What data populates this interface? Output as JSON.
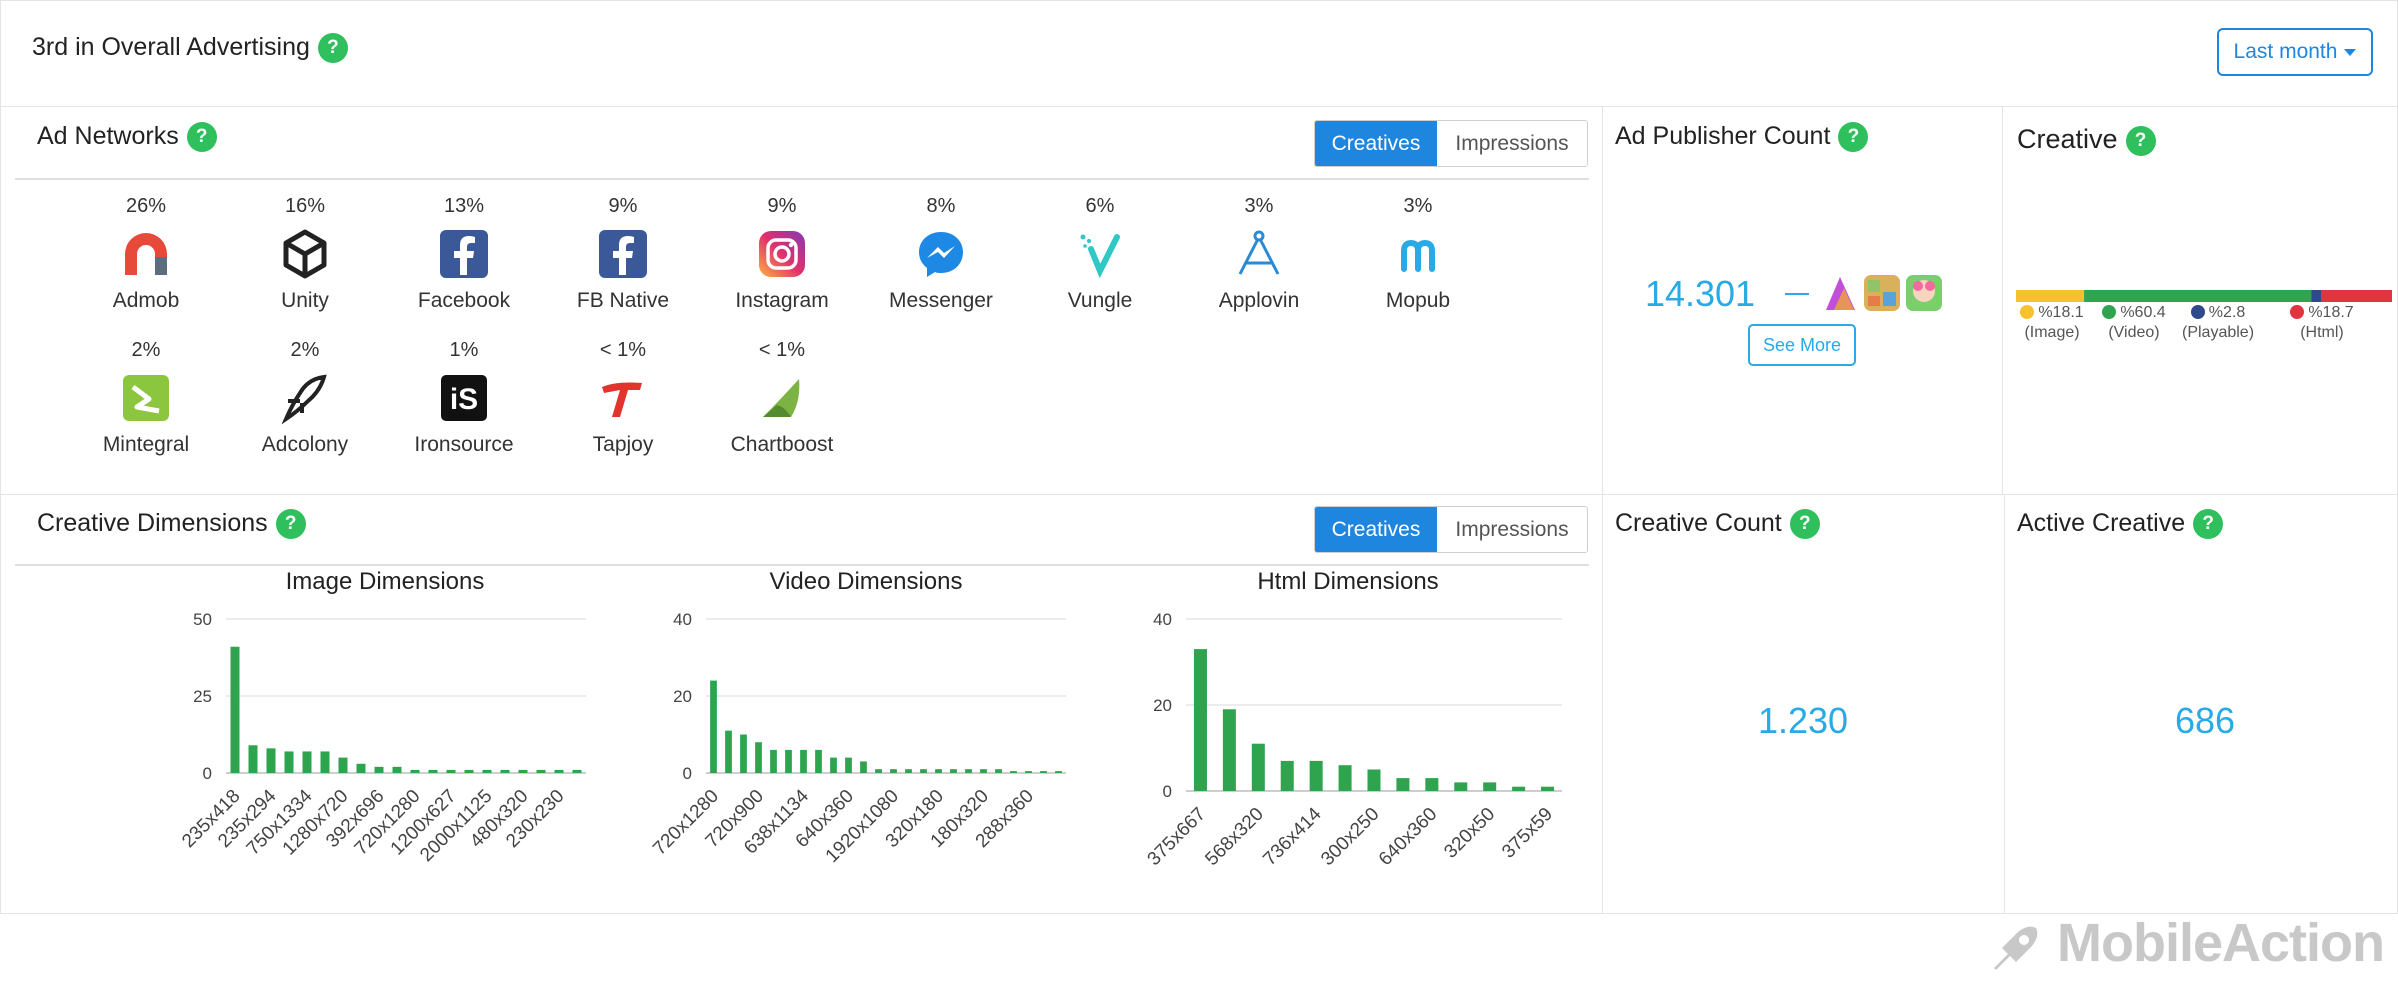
{
  "header": {
    "title": "3rd in Overall Advertising",
    "period": "Last month"
  },
  "help_glyph": "?",
  "ad_networks": {
    "title": "Ad Networks",
    "toggle": {
      "active": "Creatives",
      "inactive": "Impressions"
    },
    "items": [
      {
        "pct": "26%",
        "name": "Admob",
        "icon": "admob-icon"
      },
      {
        "pct": "16%",
        "name": "Unity",
        "icon": "unity-icon"
      },
      {
        "pct": "13%",
        "name": "Facebook",
        "icon": "facebook-icon"
      },
      {
        "pct": "9%",
        "name": "FB Native",
        "icon": "fb-native-icon"
      },
      {
        "pct": "9%",
        "name": "Instagram",
        "icon": "instagram-icon"
      },
      {
        "pct": "8%",
        "name": "Messenger",
        "icon": "messenger-icon"
      },
      {
        "pct": "6%",
        "name": "Vungle",
        "icon": "vungle-icon"
      },
      {
        "pct": "3%",
        "name": "Applovin",
        "icon": "applovin-icon"
      },
      {
        "pct": "3%",
        "name": "Mopub",
        "icon": "mopub-icon"
      },
      {
        "pct": "2%",
        "name": "Mintegral",
        "icon": "mintegral-icon"
      },
      {
        "pct": "2%",
        "name": "Adcolony",
        "icon": "adcolony-icon"
      },
      {
        "pct": "1%",
        "name": "Ironsource",
        "icon": "ironsource-icon"
      },
      {
        "pct": "< 1%",
        "name": "Tapjoy",
        "icon": "tapjoy-icon"
      },
      {
        "pct": "< 1%",
        "name": "Chartboost",
        "icon": "chartboost-icon"
      }
    ]
  },
  "publisher": {
    "title": "Ad Publisher Count",
    "count": "14.301",
    "see_more": "See More"
  },
  "creative": {
    "title": "Creative",
    "segments": [
      {
        "label": "%18.1",
        "type": "(Image)",
        "value": 18.1,
        "color": "#f5c12e"
      },
      {
        "label": "%60.4",
        "type": "(Video)",
        "value": 60.4,
        "color": "#2ea44f"
      },
      {
        "label": "%2.8",
        "type": "(Playable)",
        "value": 2.8,
        "color": "#2e4a8a"
      },
      {
        "label": "%18.7",
        "type": "(Html)",
        "value": 18.7,
        "color": "#e0343f"
      }
    ]
  },
  "dimensions": {
    "title": "Creative Dimensions",
    "toggle": {
      "active": "Creatives",
      "inactive": "Impressions"
    }
  },
  "creative_count": {
    "title": "Creative Count",
    "value": "1.230"
  },
  "active_creative": {
    "title": "Active Creative",
    "value": "686"
  },
  "brand": "MobileAction",
  "chart_data": [
    {
      "type": "bar",
      "title": "Image Dimensions",
      "ylim": [
        0,
        50
      ],
      "yticks": [
        0,
        25,
        50
      ],
      "tick_labels": [
        "235x418",
        "235x294",
        "750x1334",
        "1280x720",
        "392x696",
        "720x1280",
        "1200x627",
        "2000x1125",
        "480x320",
        "230x230"
      ],
      "values": [
        41,
        9,
        8,
        7,
        7,
        7,
        5,
        3,
        2,
        2,
        1,
        1,
        1,
        1,
        1,
        1,
        1,
        1,
        1,
        1
      ],
      "color": "#2ea44f"
    },
    {
      "type": "bar",
      "title": "Video Dimensions",
      "ylim": [
        0,
        40
      ],
      "yticks": [
        0,
        20,
        40
      ],
      "tick_labels": [
        "720x1280",
        "720x900",
        "638x1134",
        "640x360",
        "1920x1080",
        "320x180",
        "180x320",
        "288x360"
      ],
      "values": [
        24,
        11,
        10,
        8,
        6,
        6,
        6,
        6,
        4,
        4,
        3,
        1,
        1,
        1,
        1,
        1,
        1,
        1,
        1,
        1,
        0.5,
        0.5,
        0.5,
        0.5
      ],
      "color": "#2ea44f"
    },
    {
      "type": "bar",
      "title": "Html Dimensions",
      "ylim": [
        0,
        40
      ],
      "yticks": [
        0,
        20,
        40
      ],
      "tick_labels": [
        "375x667",
        "568x320",
        "736x414",
        "300x250",
        "640x360",
        "320x50",
        "375x59"
      ],
      "values": [
        33,
        19,
        11,
        7,
        7,
        6,
        5,
        3,
        3,
        2,
        2,
        1,
        1
      ],
      "color": "#2ea44f"
    }
  ]
}
